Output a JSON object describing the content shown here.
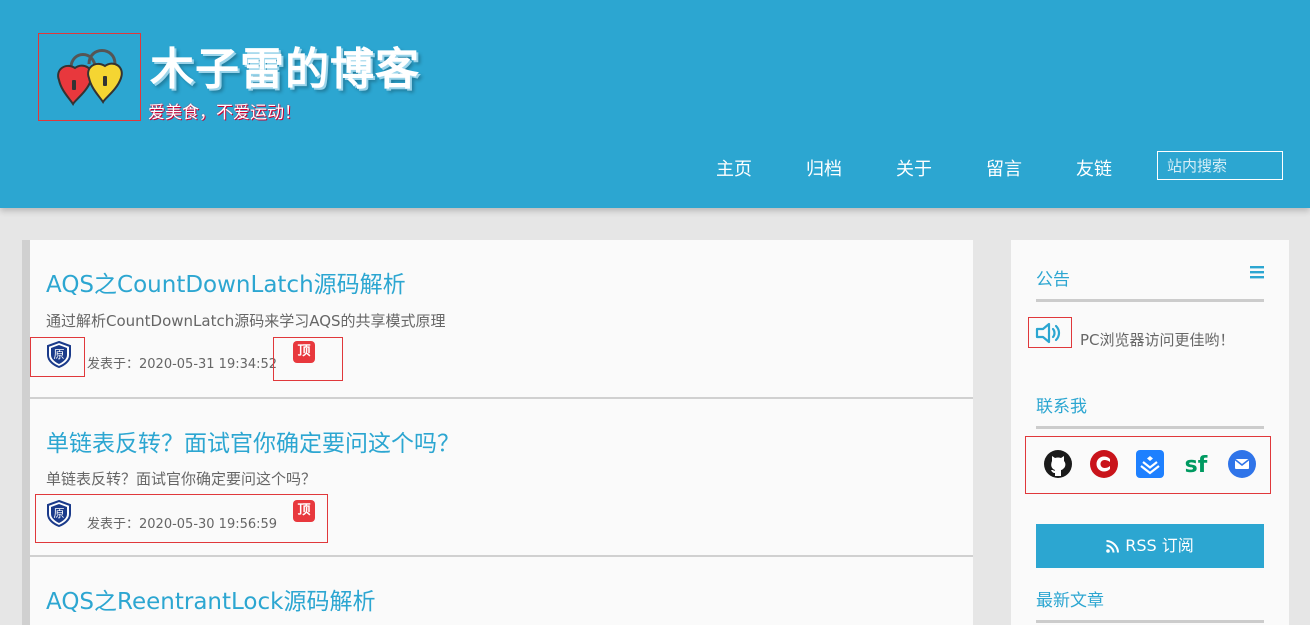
{
  "header": {
    "title": "木子雷的博客",
    "subtitle": "爱美食，不爱运动！",
    "logo_icon": "heart-locks-logo"
  },
  "nav": {
    "items": [
      "主页",
      "归档",
      "关于",
      "留言",
      "友链"
    ],
    "search_placeholder": "站内搜索"
  },
  "posts": [
    {
      "title": "AQS之CountDownLatch源码解析",
      "summary": "通过解析CountDownLatch源码来学习AQS的共享模式原理",
      "date_label": "发表于：2020-05-31 19:34:52",
      "badge_original": "原",
      "badge_top": "顶"
    },
    {
      "title": "单链表反转？面试官你确定要问这个吗？",
      "summary": "单链表反转？面试官你确定要问这个吗？",
      "date_label": "发表于：2020-05-30 19:56:59",
      "badge_original": "原",
      "badge_top": "顶"
    },
    {
      "title": "AQS之ReentrantLock源码解析"
    }
  ],
  "sidebar": {
    "notice_title": "公告",
    "notice_text": "PC浏览器访问更佳哟！",
    "contact_title": "联系我",
    "contact_icons": [
      "github-icon",
      "csdn-icon",
      "juejin-icon",
      "segmentfault-icon",
      "email-icon"
    ],
    "rss_label": "RSS 订阅",
    "latest_title": "最新文章"
  },
  "colors": {
    "accent": "#2ca6d1",
    "annotation_red": "#e0383b",
    "top_badge": "#e8383d"
  }
}
